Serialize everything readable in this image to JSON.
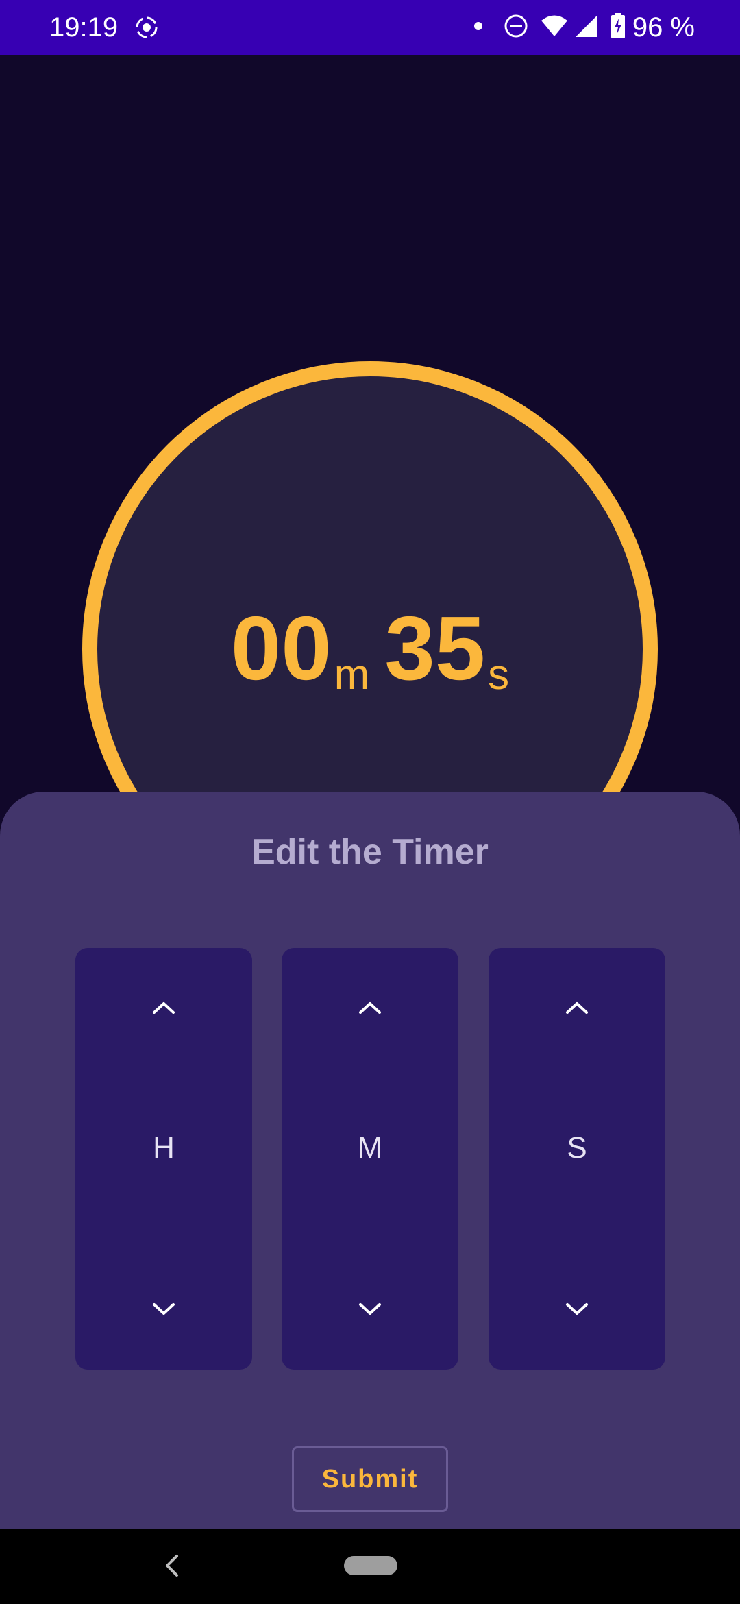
{
  "status_bar": {
    "time": "19:19",
    "battery_text": "96 %",
    "icons": [
      "cast-icon",
      "notification-dot-icon",
      "do-not-disturb-icon",
      "wifi-icon",
      "cellular-signal-icon",
      "battery-charging-icon"
    ]
  },
  "timer": {
    "minutes": "00",
    "minutes_unit": "m",
    "seconds": "35",
    "seconds_unit": "s",
    "ring_color": "#fbb73c"
  },
  "edit_sheet": {
    "title": "Edit the Timer",
    "pickers": [
      {
        "label": "H",
        "up_icon": "chevron-up-icon",
        "down_icon": "chevron-down-icon"
      },
      {
        "label": "M",
        "up_icon": "chevron-up-icon",
        "down_icon": "chevron-down-icon"
      },
      {
        "label": "S",
        "up_icon": "chevron-up-icon",
        "down_icon": "chevron-down-icon"
      }
    ],
    "submit_label": "Submit"
  },
  "nav_bar": {
    "icons": [
      "back-icon",
      "home-pill-icon"
    ]
  },
  "colors": {
    "status_bar": "#3700b3",
    "background": "#11082a",
    "sheet": "#42356b",
    "picker": "#2a1a66",
    "accent": "#fbb73c"
  }
}
